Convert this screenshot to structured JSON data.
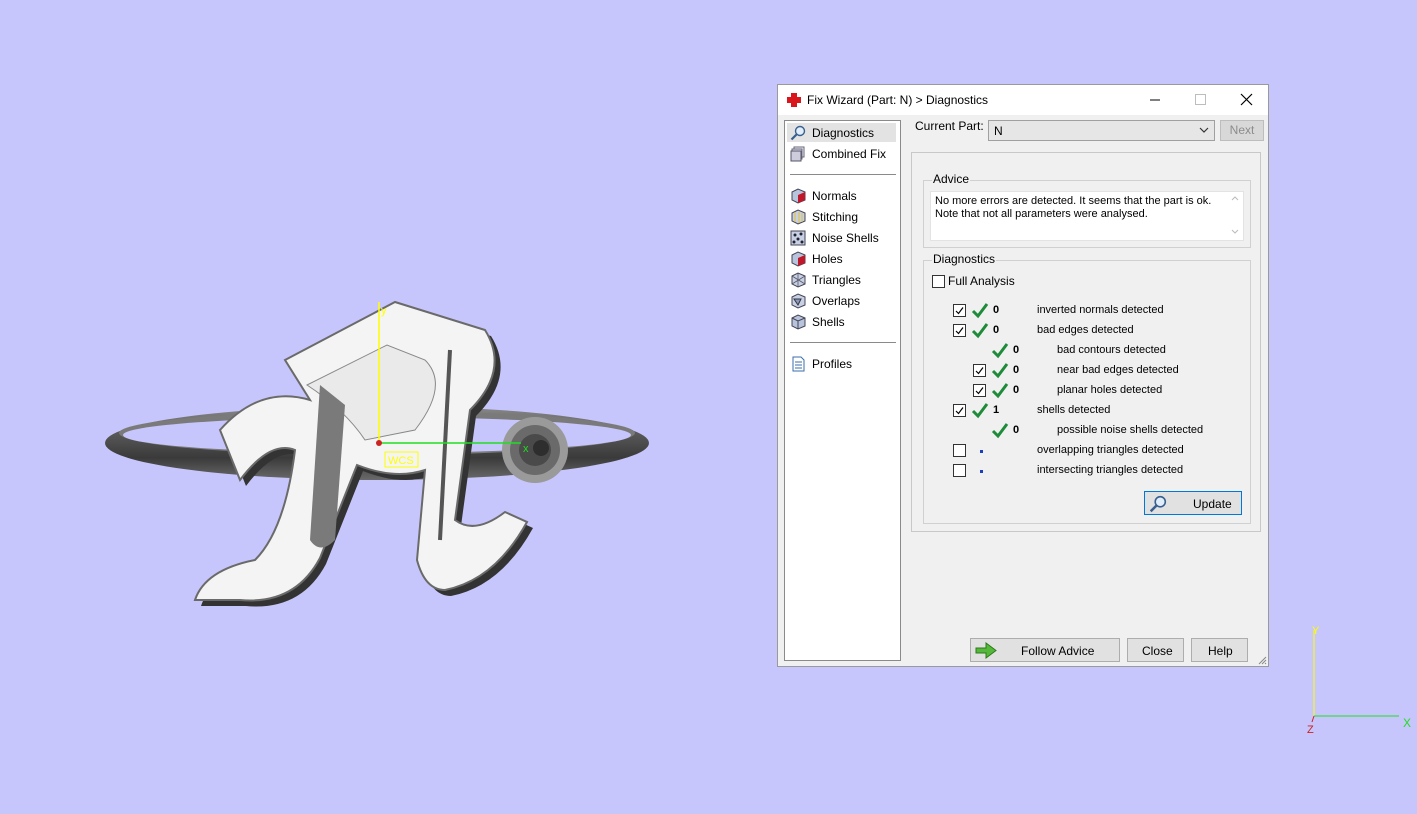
{
  "window": {
    "title": "Fix Wizard (Part: N) > Diagnostics",
    "minimize_icon": "minimize-icon",
    "maximize_icon": "maximize-icon",
    "close_icon": "close-icon"
  },
  "sidebar": {
    "items": [
      {
        "label": "Diagnostics",
        "icon": "magnifier-icon"
      },
      {
        "label": "Combined Fix",
        "icon": "combined-fix-icon"
      },
      {
        "label": "Normals",
        "icon": "normals-icon"
      },
      {
        "label": "Stitching",
        "icon": "stitching-icon"
      },
      {
        "label": "Noise Shells",
        "icon": "noise-shells-icon"
      },
      {
        "label": "Holes",
        "icon": "holes-icon"
      },
      {
        "label": "Triangles",
        "icon": "triangles-icon"
      },
      {
        "label": "Overlaps",
        "icon": "overlaps-icon"
      },
      {
        "label": "Shells",
        "icon": "shells-icon"
      },
      {
        "label": "Profiles",
        "icon": "profiles-icon"
      }
    ]
  },
  "current_part": {
    "label": "Current Part:",
    "value": "N",
    "next_label": "Next"
  },
  "advice": {
    "title": "Advice",
    "line1": "No more errors are detected. It seems that the part is ok.",
    "line2": "Note that not all parameters were analysed."
  },
  "diagnostics": {
    "title": "Diagnostics",
    "full_analysis_label": "Full Analysis",
    "full_analysis_checked": false,
    "rows": [
      {
        "checked": true,
        "count": "0",
        "label": "inverted normals detected"
      },
      {
        "checked": true,
        "count": "0",
        "label": "bad edges detected"
      },
      {
        "count": "0",
        "label": "bad contours detected"
      },
      {
        "checked": true,
        "count": "0",
        "label": "near bad edges detected"
      },
      {
        "checked": true,
        "count": "0",
        "label": "planar holes detected"
      },
      {
        "checked": true,
        "count": "1",
        "label": "shells detected"
      },
      {
        "count": "0",
        "label": "possible noise shells detected"
      },
      {
        "checked": false,
        "label": "overlapping triangles detected"
      },
      {
        "checked": false,
        "label": "intersecting triangles detected"
      }
    ],
    "update_label": "Update"
  },
  "buttons": {
    "follow_advice": "Follow Advice",
    "close": "Close",
    "help": "Help"
  },
  "viewport": {
    "wcs_label": "WCS",
    "x_label": "x",
    "y_label": "y",
    "axis_x": "X",
    "axis_y": "Y",
    "axis_z": "Z"
  },
  "colors": {
    "background": "#c6c6fc",
    "check_green": "#1e8c3a",
    "accent": "#0078d7"
  }
}
